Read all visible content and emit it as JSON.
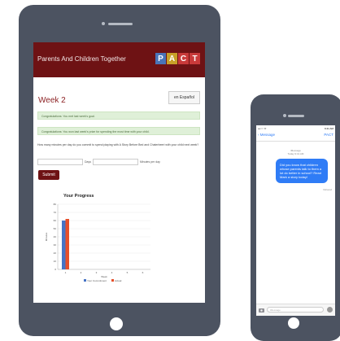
{
  "tablet": {
    "header": {
      "brand": "Parents And Children Together",
      "logo_letters": [
        "P",
        "A",
        "C",
        "T"
      ],
      "logo_colors": [
        "#4a74b8",
        "#c8a028",
        "#c93a3a",
        "#c93a3a"
      ]
    },
    "week_title": "Week 2",
    "espanol_label": "en Español",
    "alerts": [
      "Congratulations: You met last week's goal.",
      "Congratulations: You won last week's prize for spending the most time with your child."
    ],
    "question": "How many minutes per day do you commit to spend playing with A Story Before Bed and Chaterbeeri with your child next week?",
    "days_label": "Days",
    "minutes_label": "Minutes per day",
    "submit_label": "Submit",
    "chart_title": "Your Progress"
  },
  "chart_data": {
    "type": "bar",
    "title": "Your Progress",
    "xlabel": "Week",
    "ylabel": "Minutes",
    "categories": [
      "1",
      "2",
      "3",
      "4",
      "5",
      "6"
    ],
    "series": [
      {
        "name": "Your Commitment",
        "values": [
          60,
          0,
          0,
          0,
          0,
          0
        ],
        "color": "#4573c5"
      },
      {
        "name": "Actual",
        "values": [
          62,
          0,
          0,
          0,
          0,
          0
        ],
        "color": "#e64e2a"
      }
    ],
    "ylim": [
      0,
      80
    ],
    "yticks": [
      0,
      10,
      20,
      30,
      40,
      50,
      60,
      70,
      80
    ],
    "legend": "bottom"
  },
  "phone": {
    "status_left": "•••○○ ᯤ",
    "status_right": "9:41 AM",
    "back_label": "‹ Message",
    "contact_label": "PACT",
    "message_header": "iMessage",
    "message_time": "Today 9:41 AM",
    "message_text": "Did you know that children whose parents talk to them a lot do better in school? Read Mark a story today!",
    "delivered_label": "Delivered",
    "input_placeholder": "iMessage"
  },
  "colors": {
    "device_frame": "#4c5361",
    "header_bg": "#6e1214",
    "imessage_blue": "#2f7cf6"
  }
}
